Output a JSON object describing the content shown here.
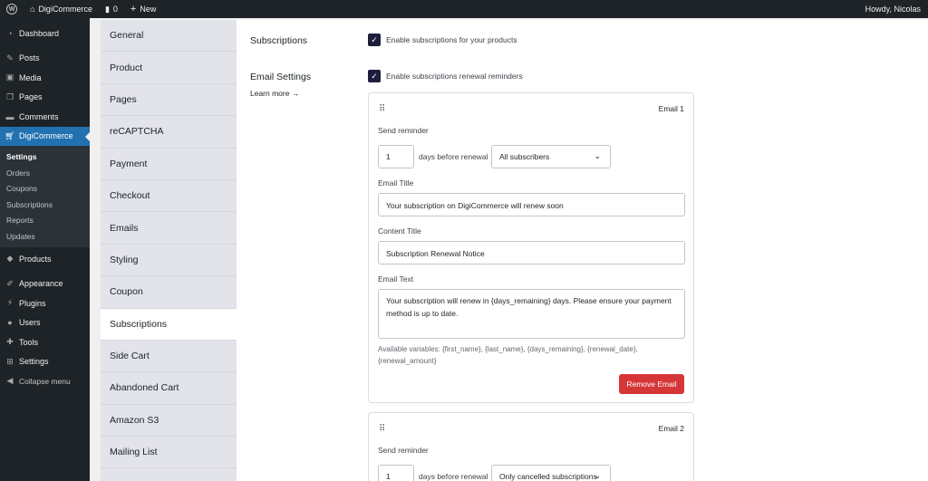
{
  "adminbar": {
    "site_name": "DigiCommerce",
    "comments_count": "0",
    "new_label": "New",
    "howdy": "Howdy, Nicolas"
  },
  "menu": {
    "items_top": [
      {
        "label": "Dashboard",
        "icon": "dashboard-icon"
      },
      {
        "label": "Posts",
        "icon": "pin-icon"
      },
      {
        "label": "Media",
        "icon": "media-icon"
      },
      {
        "label": "Pages",
        "icon": "pages-icon"
      },
      {
        "label": "Comments",
        "icon": "comments-icon"
      },
      {
        "label": "DigiCommerce",
        "icon": "cart-icon"
      }
    ],
    "submenu": [
      "Settings",
      "Orders",
      "Coupons",
      "Subscriptions",
      "Reports",
      "Updates"
    ],
    "items_bottom": [
      {
        "label": "Products"
      },
      {
        "label": "Appearance"
      },
      {
        "label": "Plugins"
      },
      {
        "label": "Users"
      },
      {
        "label": "Tools"
      },
      {
        "label": "Settings"
      },
      {
        "label": "Collapse menu"
      }
    ]
  },
  "tabs": [
    "General",
    "Product",
    "Pages",
    "reCAPTCHA",
    "Payment",
    "Checkout",
    "Emails",
    "Styling",
    "Coupon",
    "Subscriptions",
    "Side Cart",
    "Abandoned Cart",
    "Amazon S3",
    "Mailing List"
  ],
  "content": {
    "subscriptions_label": "Subscriptions",
    "enable_subscriptions": "Enable subscriptions for your products",
    "email_settings_label": "Email Settings",
    "learn_more": "Learn more →",
    "enable_reminders": "Enable subscriptions renewal reminders",
    "email1": {
      "title": "Email 1",
      "send_reminder": "Send reminder",
      "days_value": "1",
      "days_before": "days before renewal",
      "audience": "All subscribers",
      "email_title_label": "Email Title",
      "email_title_value": "Your subscription on DigiCommerce will renew soon",
      "content_title_label": "Content Title",
      "content_title_value": "Subscription Renewal Notice",
      "email_text_label": "Email Text",
      "email_text_value": "Your subscription will renew in {days_remaining} days. Please ensure your payment method is up to date.",
      "variables": "Available variables: {first_name}, {last_name}, {days_remaining}, {renewal_date}, {renewal_amount}",
      "remove_label": "Remove Email"
    },
    "email2": {
      "title": "Email 2",
      "send_reminder": "Send reminder",
      "days_value": "1",
      "days_before": "days before renewal",
      "audience": "Only cancelled subscriptions"
    }
  }
}
